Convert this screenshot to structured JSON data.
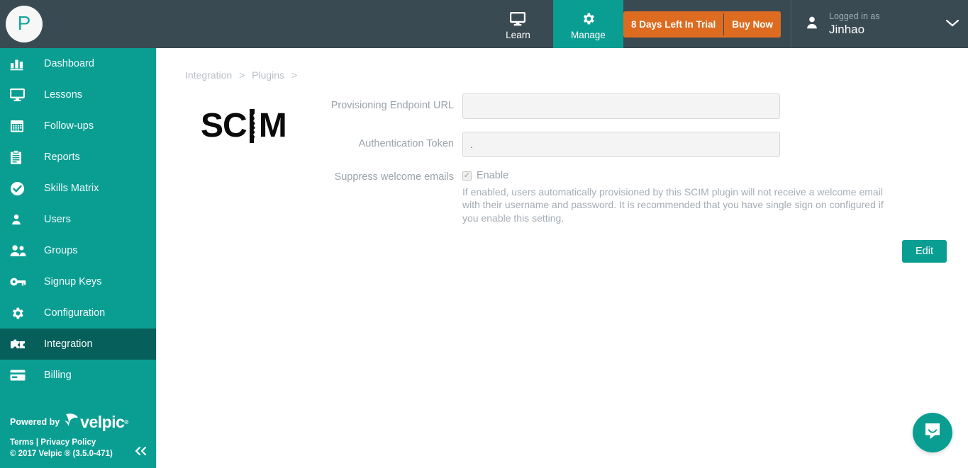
{
  "header": {
    "brand_initial": "P",
    "tabs": [
      {
        "label": "Learn",
        "icon": "monitor-icon",
        "active": false
      },
      {
        "label": "Manage",
        "icon": "gear-icon",
        "active": true
      }
    ],
    "trial": {
      "days_label": "8 Days Left In Trial",
      "buy_label": "Buy Now",
      "accent": "#dd6b20"
    },
    "user": {
      "logged_in_label": "Logged in as",
      "name": "Jinhao",
      "icon": "person-icon",
      "chevron": "chevron-down-icon"
    }
  },
  "sidebar": {
    "accent": "#0a9e93",
    "active_accent": "#065f5b",
    "items": [
      {
        "label": "Dashboard",
        "icon": "bar-chart-icon",
        "active": false
      },
      {
        "label": "Lessons",
        "icon": "monitor-icon",
        "active": false
      },
      {
        "label": "Follow-ups",
        "icon": "calendar-icon",
        "active": false
      },
      {
        "label": "Reports",
        "icon": "clipboard-icon",
        "active": false
      },
      {
        "label": "Skills Matrix",
        "icon": "check-circle-icon",
        "active": false
      },
      {
        "label": "Users",
        "icon": "person-icon",
        "active": false
      },
      {
        "label": "Groups",
        "icon": "people-icon",
        "active": false
      },
      {
        "label": "Signup Keys",
        "icon": "key-icon",
        "active": false
      },
      {
        "label": "Configuration",
        "icon": "gear-icon",
        "active": false
      },
      {
        "label": "Integration",
        "icon": "puzzle-icon",
        "active": true
      },
      {
        "label": "Billing",
        "icon": "credit-card-icon",
        "active": false
      }
    ],
    "footer": {
      "powered_by": "Powered by",
      "brand": "velpic",
      "brand_tm": "®",
      "links": "Terms | Privacy Policy",
      "copyright": "© 2017 Velpic ® (3.5.0-471)",
      "collapse_icon": "chevron-double-left-icon"
    }
  },
  "main": {
    "breadcrumb": [
      {
        "label": "Integration",
        "sep": ">"
      },
      {
        "label": "Plugins",
        "sep": ">"
      }
    ],
    "plugin": {
      "logo_text": "SCIM",
      "logo_alt": "scim-logo"
    },
    "form": {
      "fields": [
        {
          "label": "Provisioning Endpoint URL",
          "value": "",
          "placeholder": ""
        },
        {
          "label": "Authentication Token",
          "value": ".",
          "placeholder": ""
        }
      ],
      "checkbox": {
        "label": "Suppress welcome emails",
        "option_label": "Enable",
        "checked": true,
        "help_text": "If enabled, users automatically provisioned by this SCIM plugin will not receive a welcome email with their username and password. It is recommended that you have single sign on configured if you enable this setting."
      },
      "edit_label": "Edit"
    }
  },
  "intercom": {
    "icon": "chat-bubble-icon",
    "accent": "#0a9e93"
  }
}
